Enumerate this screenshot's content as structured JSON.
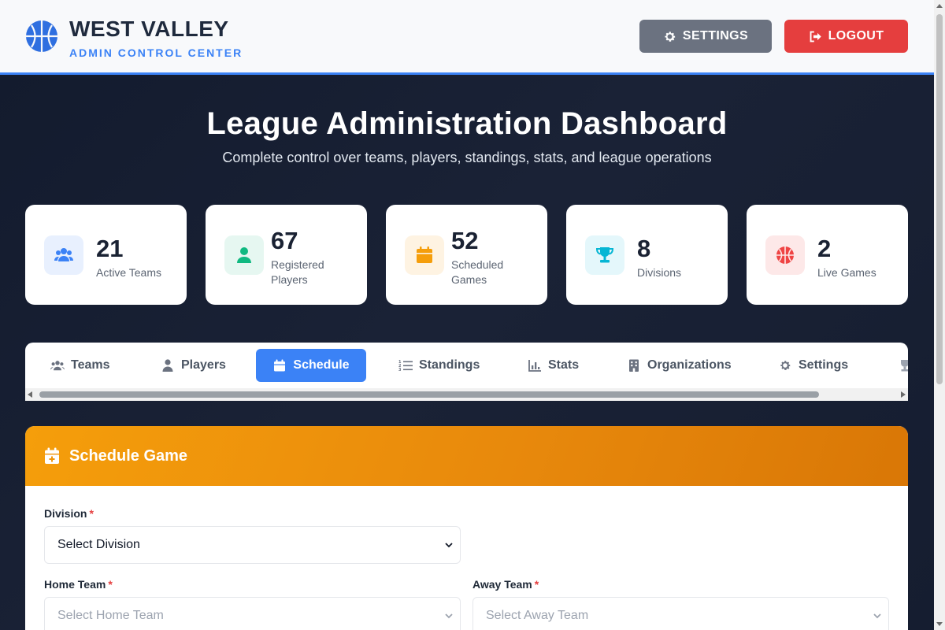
{
  "header": {
    "title": "WEST VALLEY",
    "subtitle": "ADMIN CONTROL CENTER",
    "settings_label": "SETTINGS",
    "logout_label": "LOGOUT",
    "logo_icon": "basketball-icon"
  },
  "hero": {
    "title": "League Administration Dashboard",
    "subtitle": "Complete control over teams, players, standings, stats, and league operations"
  },
  "stats": [
    {
      "value": "21",
      "label": "Active Teams",
      "icon": "users-icon",
      "color": "#3b82f6",
      "bg": "#e8f0fe"
    },
    {
      "value": "67",
      "label": "Registered Players",
      "icon": "user-icon",
      "color": "#10b981",
      "bg": "#e6f7f1"
    },
    {
      "value": "52",
      "label": "Scheduled Games",
      "icon": "calendar-icon",
      "color": "#f59e0b",
      "bg": "#fef3e2"
    },
    {
      "value": "8",
      "label": "Divisions",
      "icon": "trophy-icon",
      "color": "#06b6d4",
      "bg": "#e4f7fb"
    },
    {
      "value": "2",
      "label": "Live Games",
      "icon": "basketball-icon",
      "color": "#ef4444",
      "bg": "#fde8e8"
    }
  ],
  "tabs": [
    {
      "label": "Teams",
      "icon": "users-icon"
    },
    {
      "label": "Players",
      "icon": "user-icon"
    },
    {
      "label": "Schedule",
      "icon": "calendar-icon",
      "active": true
    },
    {
      "label": "Standings",
      "icon": "list-ol-icon"
    },
    {
      "label": "Stats",
      "icon": "chart-bar-icon"
    },
    {
      "label": "Organizations",
      "icon": "building-icon"
    },
    {
      "label": "Settings",
      "icon": "gear-icon"
    }
  ],
  "schedule_form": {
    "title": "Schedule Game",
    "division_label": "Division",
    "division_value": "Select Division",
    "home_label": "Home Team",
    "home_placeholder": "Select Home Team",
    "away_label": "Away Team",
    "away_placeholder": "Select Away Team",
    "required_mark": "*"
  },
  "colors": {
    "accent": "#3b82f6",
    "danger": "#e53e3e",
    "panel_header": "#f59e0b",
    "dark_bg": "#141c2e"
  }
}
